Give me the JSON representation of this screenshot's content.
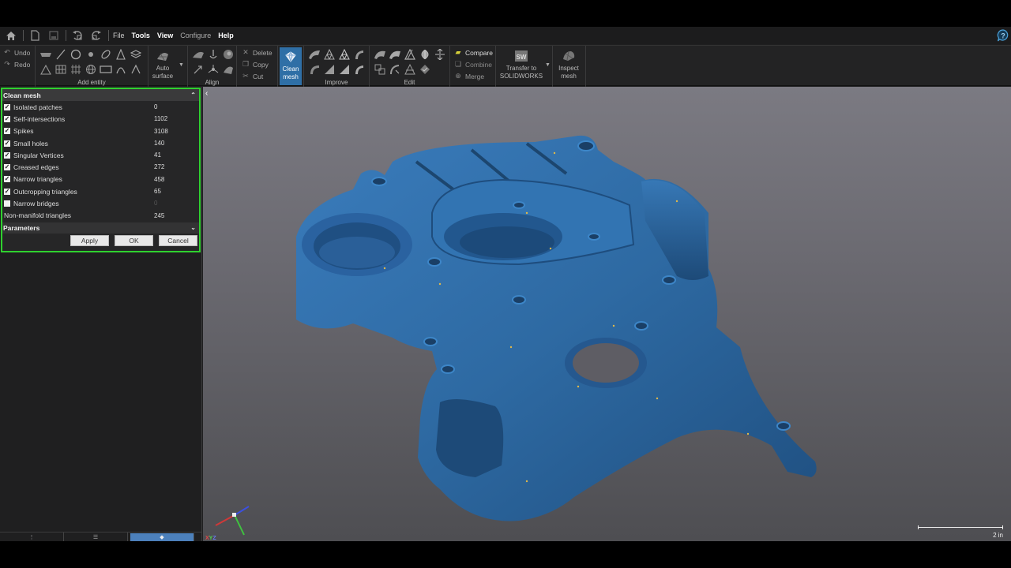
{
  "menu": {
    "items": [
      {
        "label": "File",
        "style": "normal"
      },
      {
        "label": "Tools",
        "style": "bold"
      },
      {
        "label": "View",
        "style": "bold"
      },
      {
        "label": "Configure",
        "style": "dim"
      },
      {
        "label": "Help",
        "style": "bold"
      }
    ],
    "quick_access": [
      "home-icon",
      "new-document-icon",
      "save-icon",
      "undo-history-icon",
      "redo-history-icon"
    ]
  },
  "ribbon": {
    "history": {
      "undo": "Undo",
      "redo": "Redo"
    },
    "add_entity": {
      "label": "Add entity"
    },
    "auto_surface": {
      "line1": "Auto",
      "line2": "surface"
    },
    "align": {
      "label": "Align"
    },
    "clipboard": {
      "delete": "Delete",
      "copy": "Copy",
      "cut": "Cut"
    },
    "clean_mesh": {
      "line1": "Clean",
      "line2": "mesh"
    },
    "improve": {
      "label": "Improve"
    },
    "edit": {
      "label": "Edit"
    },
    "combine_group": {
      "compare": "Compare",
      "combine": "Combine",
      "merge": "Merge"
    },
    "transfer": {
      "line1": "Transfer to",
      "line2": "SOLIDWORKS"
    },
    "inspect": {
      "line1": "Inspect",
      "line2": "mesh"
    }
  },
  "panel": {
    "title": "Clean mesh",
    "rows": [
      {
        "label": "Isolated patches",
        "value": "0",
        "checked": true
      },
      {
        "label": "Self-intersections",
        "value": "1102",
        "checked": true
      },
      {
        "label": "Spikes",
        "value": "3108",
        "checked": true
      },
      {
        "label": "Small holes",
        "value": "140",
        "checked": true
      },
      {
        "label": "Singular Vertices",
        "value": "41",
        "checked": true
      },
      {
        "label": "Creased edges",
        "value": "272",
        "checked": true
      },
      {
        "label": "Narrow triangles",
        "value": "458",
        "checked": true
      },
      {
        "label": "Outcropping triangles",
        "value": "65",
        "checked": true
      },
      {
        "label": "Narrow bridges",
        "value": "0",
        "checked": false
      }
    ],
    "non_manifold": {
      "label": "Non-manifold triangles",
      "value": "245"
    },
    "parameters_label": "Parameters",
    "buttons": {
      "apply": "Apply",
      "ok": "OK",
      "cancel": "Cancel"
    }
  },
  "viewport": {
    "scale_label": "2 in",
    "axes": {
      "x": "X",
      "y": "Y",
      "z": "Z"
    },
    "mesh_color": "#2e6aa3"
  },
  "colors": {
    "highlight_border": "#2fd12f",
    "active_ribbon": "#2f6fa6",
    "axis_x": "#d03838",
    "axis_y": "#3fc23f",
    "axis_z": "#3c50e0"
  }
}
